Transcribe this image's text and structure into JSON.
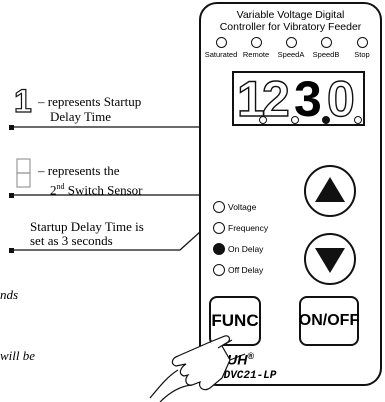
{
  "controller": {
    "title_line1": "Variable Voltage Digital",
    "title_line2": "Controller for Vibratory Feeder",
    "leds": [
      "Saturated",
      "Remote",
      "SpeedA",
      "SpeedB",
      "Stop"
    ],
    "display_digits": [
      "1",
      "2",
      "3",
      "0"
    ],
    "indicators": [
      "Voltage",
      "Frequency",
      "On Delay",
      "Off Delay"
    ],
    "func_label": "FUNC",
    "onoff_label": "ON/OFF",
    "brand": "CUH",
    "brand_mark": "®",
    "model": "SDVC21-LP"
  },
  "annotations": {
    "note1_line1": "– represents Startup",
    "note1_line2": "Delay Time",
    "note2_line1": "– represents the",
    "note2_line2_pre": "2",
    "note2_line2_sup": "nd",
    "note2_line2_post": " Switch Sensor",
    "note3_line1": "Startup Delay Time is",
    "note3_line2": "set as 3 seconds",
    "partial1": "nds",
    "partial2": "will be"
  },
  "colors": {
    "ink": "#111111",
    "panel_bg": "#ffffff"
  },
  "icons": {
    "up": "triangle-up-icon",
    "down": "triangle-down-icon",
    "hand": "pointing-hand-icon"
  }
}
